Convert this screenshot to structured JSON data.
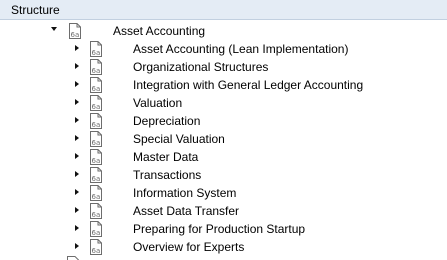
{
  "header": {
    "title": "Structure"
  },
  "tree": {
    "root": {
      "label": "Asset Accounting",
      "expanded": true,
      "icon": "document-icon"
    },
    "children": [
      {
        "label": "Asset Accounting (Lean Implementation)"
      },
      {
        "label": "Organizational Structures"
      },
      {
        "label": "Integration with General Ledger Accounting"
      },
      {
        "label": "Valuation"
      },
      {
        "label": "Depreciation"
      },
      {
        "label": "Special Valuation"
      },
      {
        "label": "Master Data"
      },
      {
        "label": "Transactions"
      },
      {
        "label": "Information System"
      },
      {
        "label": "Asset Data Transfer"
      },
      {
        "label": "Preparing for Production Startup"
      },
      {
        "label": "Overview for Experts"
      }
    ]
  },
  "icons": {
    "toggle_expanded": "triangle-down-icon",
    "toggle_collapsed": "triangle-right-icon",
    "node": "document-icon"
  },
  "colors": {
    "header_bg": "#e4ecf5",
    "header_border": "#c2d0e0",
    "icon_stroke": "#6d6d6d"
  }
}
